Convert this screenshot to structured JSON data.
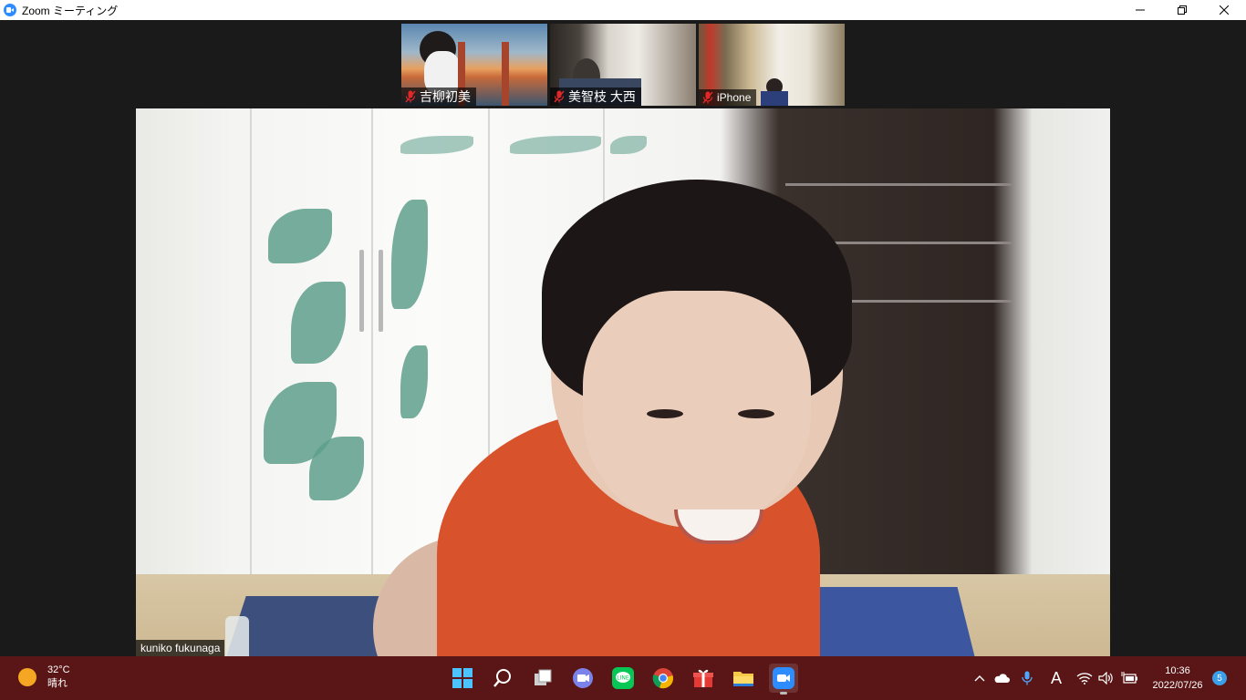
{
  "window": {
    "title": "Zoom ミーティング"
  },
  "participants": [
    {
      "name": "吉柳初美",
      "muted": true
    },
    {
      "name": "美智枝 大西",
      "muted": true
    },
    {
      "name": "iPhone",
      "muted": true
    }
  ],
  "active_speaker": {
    "name": "kuniko fukunaga"
  },
  "taskbar": {
    "weather": {
      "temp": "32°C",
      "condition": "晴れ"
    },
    "apps": [
      "windows-start",
      "search",
      "task-view",
      "teams-chat",
      "line",
      "chrome",
      "gift",
      "file-explorer",
      "zoom"
    ],
    "ime": "A",
    "clock": {
      "time": "10:36",
      "date": "2022/07/26"
    },
    "notifications": "5"
  },
  "colors": {
    "zoom_blue": "#2d8cff",
    "taskbar": "#5a1616",
    "mute_red": "#e02828"
  }
}
